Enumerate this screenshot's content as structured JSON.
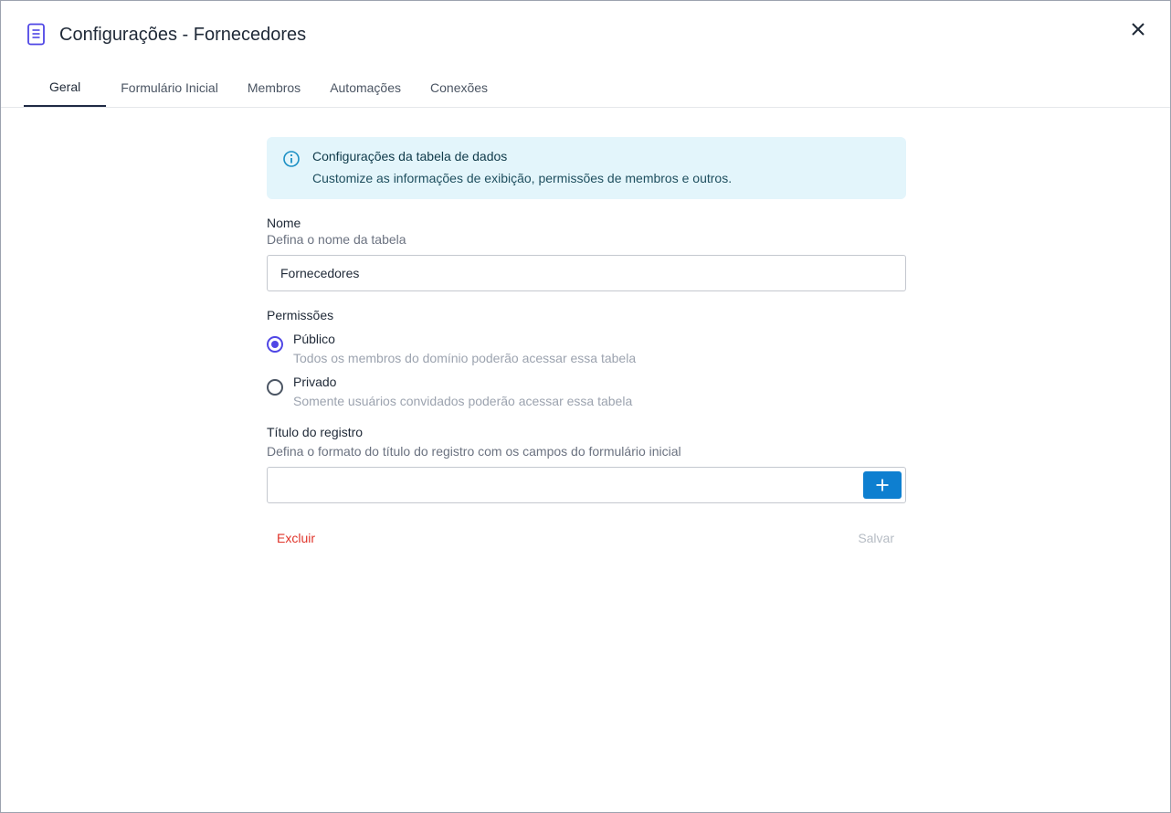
{
  "dialog": {
    "title": "Configurações - Fornecedores",
    "icon": "document-icon",
    "close_icon": "close-icon"
  },
  "tabs": [
    {
      "label": "Geral",
      "active": true
    },
    {
      "label": "Formulário Inicial",
      "active": false
    },
    {
      "label": "Membros",
      "active": false
    },
    {
      "label": "Automações",
      "active": false
    },
    {
      "label": "Conexões",
      "active": false
    }
  ],
  "info": {
    "icon": "info-icon",
    "title": "Configurações da tabela de dados",
    "description": "Customize as informações de exibição, permissões de membros e outros."
  },
  "name_field": {
    "label": "Nome",
    "hint": "Defina o nome da tabela",
    "value": "Fornecedores"
  },
  "permissions": {
    "label": "Permissões",
    "options": [
      {
        "label": "Público",
        "description": "Todos os membros do domínio poderão acessar essa tabela",
        "selected": true
      },
      {
        "label": "Privado",
        "description": "Somente usuários convidados poderão acessar essa tabela",
        "selected": false
      }
    ]
  },
  "record_title": {
    "label": "Título do registro",
    "hint": "Defina o formato do título do registro com os campos do formulário inicial",
    "value": "",
    "add_icon": "plus-icon"
  },
  "actions": {
    "delete_label": "Excluir",
    "save_label": "Salvar"
  },
  "colors": {
    "accent": "#4f46e5",
    "primary_button": "#0e7fd0",
    "danger": "#e0342a",
    "info_bg": "#e3f5fb",
    "disabled": "#b6bcc4"
  }
}
